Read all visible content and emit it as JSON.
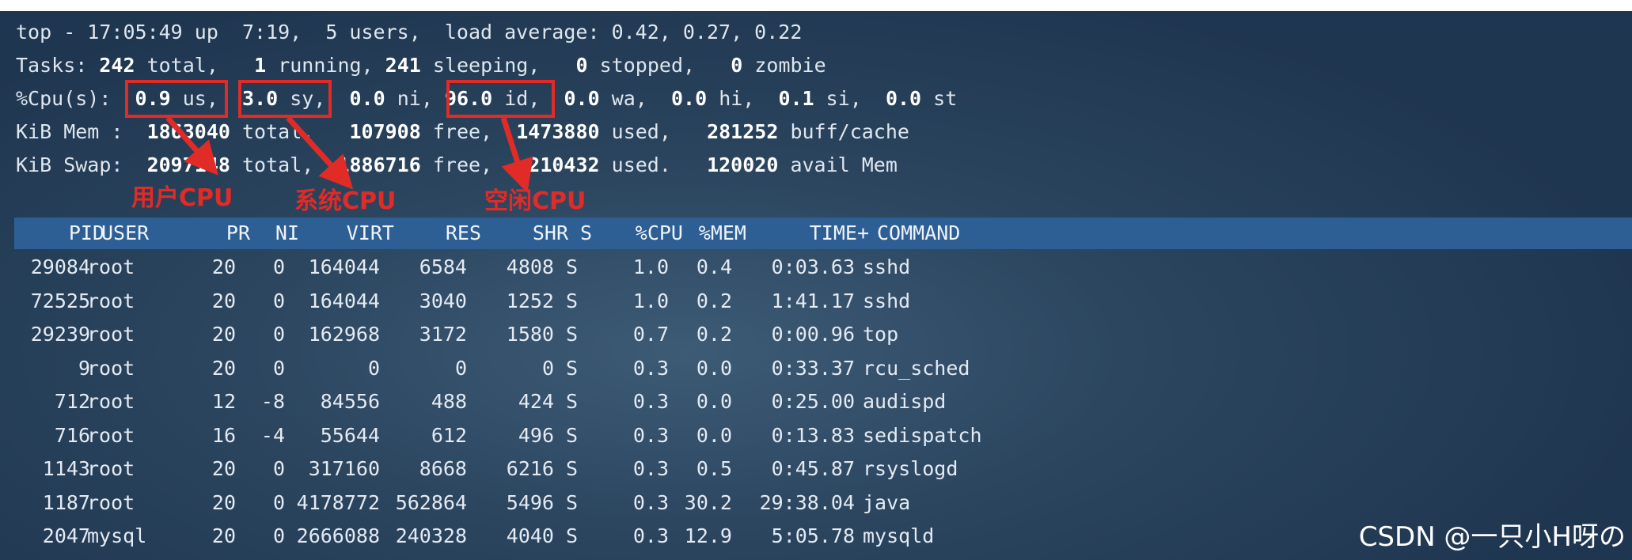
{
  "summary": {
    "line1": "top - 17:05:49 up  7:19,  5 users,  load average: 0.42, 0.27, 0.22",
    "tasks": {
      "label": "Tasks:",
      "total": "242",
      "total_label": "total,",
      "running": "1",
      "running_label": "running,",
      "sleeping": "241",
      "sleeping_label": "sleeping,",
      "stopped": "0",
      "stopped_label": "stopped,",
      "zombie": "0",
      "zombie_label": "zombie"
    },
    "cpu": {
      "label": "%Cpu(s):",
      "us": "0.9",
      "us_label": "us,",
      "sy": "3.0",
      "sy_label": "sy,",
      "ni": "0.0",
      "ni_label": "ni,",
      "id": "96.0",
      "id_label": "id,",
      "wa": "0.0",
      "wa_label": "wa,",
      "hi": "0.0",
      "hi_label": "hi,",
      "si": "0.1",
      "si_label": "si,",
      "st": "0.0",
      "st_label": "st"
    },
    "mem": {
      "label": "KiB Mem :",
      "total": "1863040",
      "total_label": "total,",
      "free": "107908",
      "free_label": "free,",
      "used": "1473880",
      "used_label": "used,",
      "buff": "281252",
      "buff_label": "buff/cache"
    },
    "swap": {
      "label": "KiB Swap:",
      "total": "2097148",
      "total_label": "total,",
      "free": "1886716",
      "free_label": "free,",
      "used": "210432",
      "used_label": "used.",
      "avail": "120020",
      "avail_label": "avail Mem"
    }
  },
  "annotations": {
    "user_cpu": "用户CPU",
    "system_cpu": "系统CPU",
    "idle_cpu": "空闲CPU",
    "color": "#e12b27"
  },
  "columns": {
    "pid": "PID",
    "user": "USER",
    "pr": "PR",
    "ni": "NI",
    "virt": "VIRT",
    "res": "RES",
    "shr": "SHR",
    "s": "S",
    "cpu": "%CPU",
    "mem": "%MEM",
    "time": "TIME+",
    "command": "COMMAND"
  },
  "processes": [
    {
      "pid": "29084",
      "user": "root",
      "pr": "20",
      "ni": "0",
      "virt": "164044",
      "res": "6584",
      "shr": "4808",
      "s": "S",
      "cpu": "1.0",
      "mem": "0.4",
      "time": "0:03.63",
      "command": "sshd"
    },
    {
      "pid": "72525",
      "user": "root",
      "pr": "20",
      "ni": "0",
      "virt": "164044",
      "res": "3040",
      "shr": "1252",
      "s": "S",
      "cpu": "1.0",
      "mem": "0.2",
      "time": "1:41.17",
      "command": "sshd"
    },
    {
      "pid": "29239",
      "user": "root",
      "pr": "20",
      "ni": "0",
      "virt": "162968",
      "res": "3172",
      "shr": "1580",
      "s": "S",
      "cpu": "0.7",
      "mem": "0.2",
      "time": "0:00.96",
      "command": "top"
    },
    {
      "pid": "9",
      "user": "root",
      "pr": "20",
      "ni": "0",
      "virt": "0",
      "res": "0",
      "shr": "0",
      "s": "S",
      "cpu": "0.3",
      "mem": "0.0",
      "time": "0:33.37",
      "command": "rcu_sched"
    },
    {
      "pid": "712",
      "user": "root",
      "pr": "12",
      "ni": "-8",
      "virt": "84556",
      "res": "488",
      "shr": "424",
      "s": "S",
      "cpu": "0.3",
      "mem": "0.0",
      "time": "0:25.00",
      "command": "audispd"
    },
    {
      "pid": "716",
      "user": "root",
      "pr": "16",
      "ni": "-4",
      "virt": "55644",
      "res": "612",
      "shr": "496",
      "s": "S",
      "cpu": "0.3",
      "mem": "0.0",
      "time": "0:13.83",
      "command": "sedispatch"
    },
    {
      "pid": "1143",
      "user": "root",
      "pr": "20",
      "ni": "0",
      "virt": "317160",
      "res": "8668",
      "shr": "6216",
      "s": "S",
      "cpu": "0.3",
      "mem": "0.5",
      "time": "0:45.87",
      "command": "rsyslogd"
    },
    {
      "pid": "1187",
      "user": "root",
      "pr": "20",
      "ni": "0",
      "virt": "4178772",
      "res": "562864",
      "shr": "5496",
      "s": "S",
      "cpu": "0.3",
      "mem": "30.2",
      "time": "29:38.04",
      "command": "java"
    },
    {
      "pid": "2047",
      "user": "mysql",
      "pr": "20",
      "ni": "0",
      "virt": "2666088",
      "res": "240328",
      "shr": "4040",
      "s": "S",
      "cpu": "0.3",
      "mem": "12.9",
      "time": "5:05.78",
      "command": "mysqld"
    }
  ],
  "watermark": "CSDN @一只小H呀の"
}
